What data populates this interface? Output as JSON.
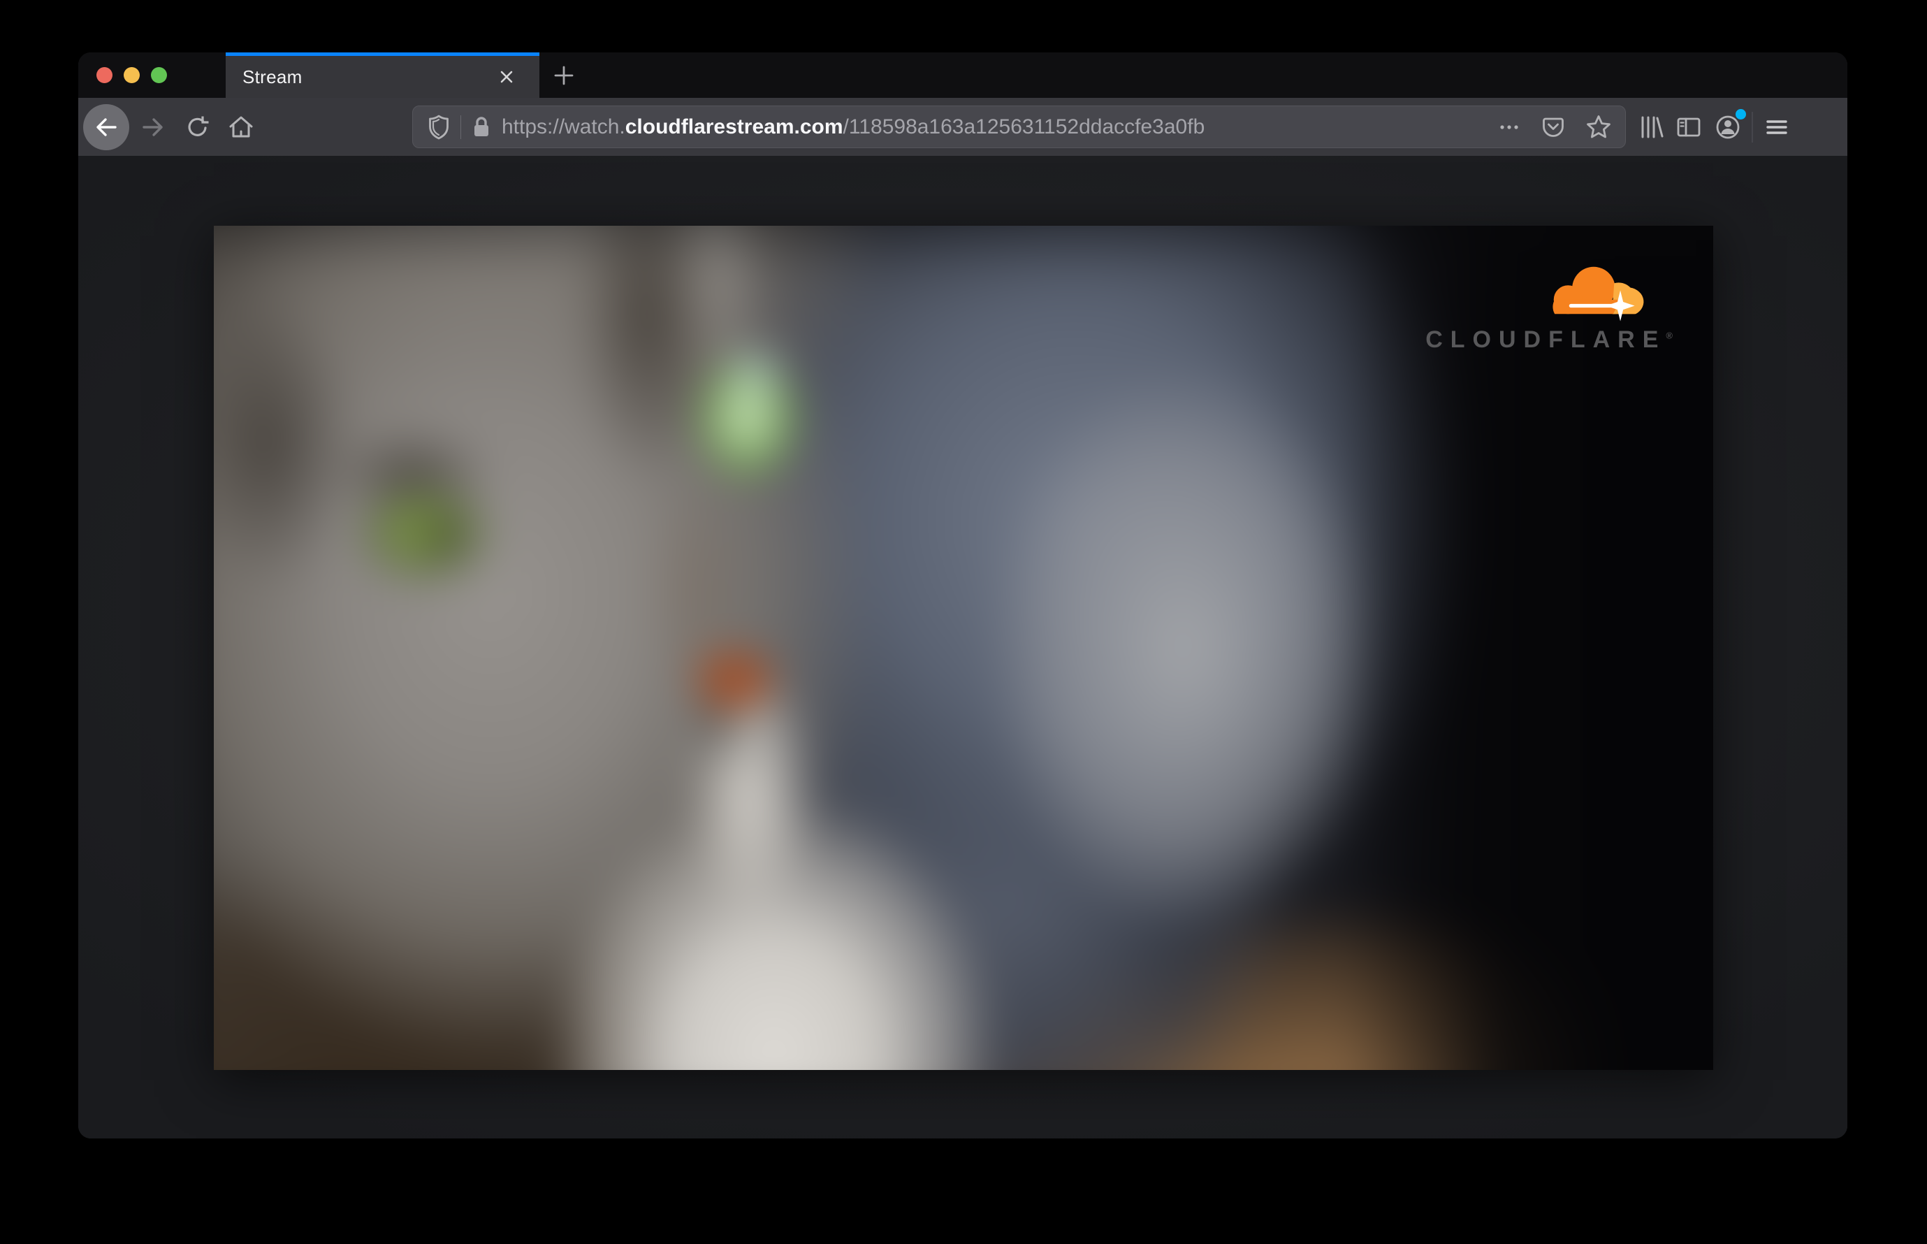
{
  "window_controls": {
    "close": "close-window",
    "minimize": "minimize-window",
    "zoom": "zoom-window"
  },
  "tab_bar": {
    "active_tab": {
      "title": "Stream"
    }
  },
  "toolbar": {
    "url_bar": {
      "url_prefix": "https://watch.",
      "url_domain": "cloudflarestream.com",
      "url_path": "/118598a163a125631152ddaccfe3a0fb"
    }
  },
  "content": {
    "video_overlay": {
      "brand": "CLOUDFLARE",
      "brand_mark": "®"
    }
  },
  "icons": {
    "tab_close": "close-icon",
    "new_tab": "plus-icon",
    "nav": [
      "back-icon",
      "forward-icon",
      "reload-icon",
      "home-icon"
    ],
    "url_bar_left": [
      "tracking-protection-shield-icon",
      "lock-icon"
    ],
    "url_bar_right": [
      "page-actions-ellipsis-icon",
      "pocket-icon",
      "bookmark-star-icon"
    ],
    "toolbar_right": [
      "library-icon",
      "sidebar-icon",
      "account-icon",
      "hamburger-menu-icon"
    ]
  },
  "colors": {
    "accent_blue": "#0a84ff",
    "traffic_red": "#ed6a5e",
    "traffic_yellow": "#f5bf4f",
    "traffic_green": "#62c554",
    "tab_bar_bg": "#0f0f11",
    "toolbar_bg": "#38383d",
    "url_bar_bg": "#47474d",
    "content_bg": "#212226",
    "notification_dot": "#00b3f4",
    "cloudflare_orange": "#f6821f",
    "cloudflare_orange_light": "#fbad41"
  }
}
